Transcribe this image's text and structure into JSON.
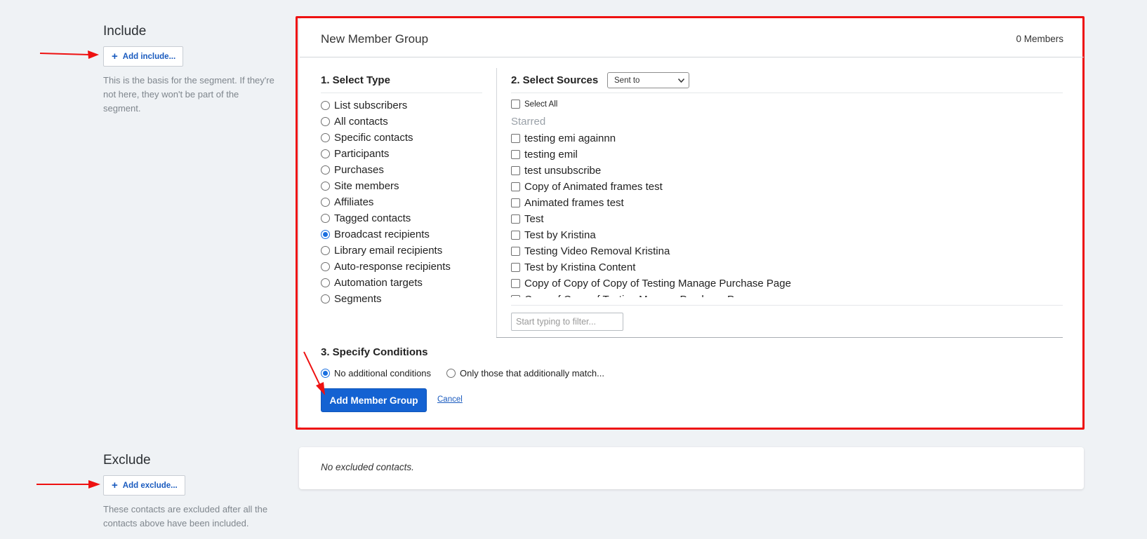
{
  "include": {
    "title": "Include",
    "add_button": "Add include...",
    "description_lines": [
      "This is the basis for the segment. If they're",
      "not here, they won't be part of the",
      "segment."
    ]
  },
  "exclude": {
    "title": "Exclude",
    "add_button": "Add exclude...",
    "description_lines": [
      "These contacts are excluded after all the",
      "contacts above have been included."
    ],
    "empty_text": "No excluded contacts."
  },
  "group_card": {
    "title": "New Member Group",
    "member_count": "0 Members",
    "select_type": {
      "title": "1. Select Type",
      "options": [
        {
          "label": "List subscribers",
          "checked": false
        },
        {
          "label": "All contacts",
          "checked": false
        },
        {
          "label": "Specific contacts",
          "checked": false
        },
        {
          "label": "Participants",
          "checked": false
        },
        {
          "label": "Purchases",
          "checked": false
        },
        {
          "label": "Site members",
          "checked": false
        },
        {
          "label": "Affiliates",
          "checked": false
        },
        {
          "label": "Tagged contacts",
          "checked": false
        },
        {
          "label": "Broadcast recipients",
          "checked": true
        },
        {
          "label": "Library email recipients",
          "checked": false
        },
        {
          "label": "Auto-response recipients",
          "checked": false
        },
        {
          "label": "Automation targets",
          "checked": false
        },
        {
          "label": "Segments",
          "checked": false
        }
      ]
    },
    "select_sources": {
      "title": "2. Select Sources",
      "dropdown_value": "Sent to",
      "select_all": "Select All",
      "starred_label": "Starred",
      "sources": [
        "testing emi againnn",
        "testing emil",
        "test unsubscribe",
        "Copy of Animated frames test",
        "Animated frames test",
        "Test",
        "Test by Kristina",
        "Testing Video Removal Kristina",
        "Test by Kristina Content",
        "Copy of Copy of Copy of Testing Manage Purchase Page",
        "Copy of Copy of Testing Manage Purchase Page"
      ],
      "filter_placeholder": "Start typing to filter..."
    },
    "conditions": {
      "title": "3. Specify Conditions",
      "option_none": "No additional conditions",
      "option_match": "Only those that additionally match...",
      "selected": "none"
    },
    "add_button": "Add Member Group",
    "cancel_link": "Cancel"
  },
  "annotation_color": "#ee1111",
  "accent_color": "#1462d2"
}
